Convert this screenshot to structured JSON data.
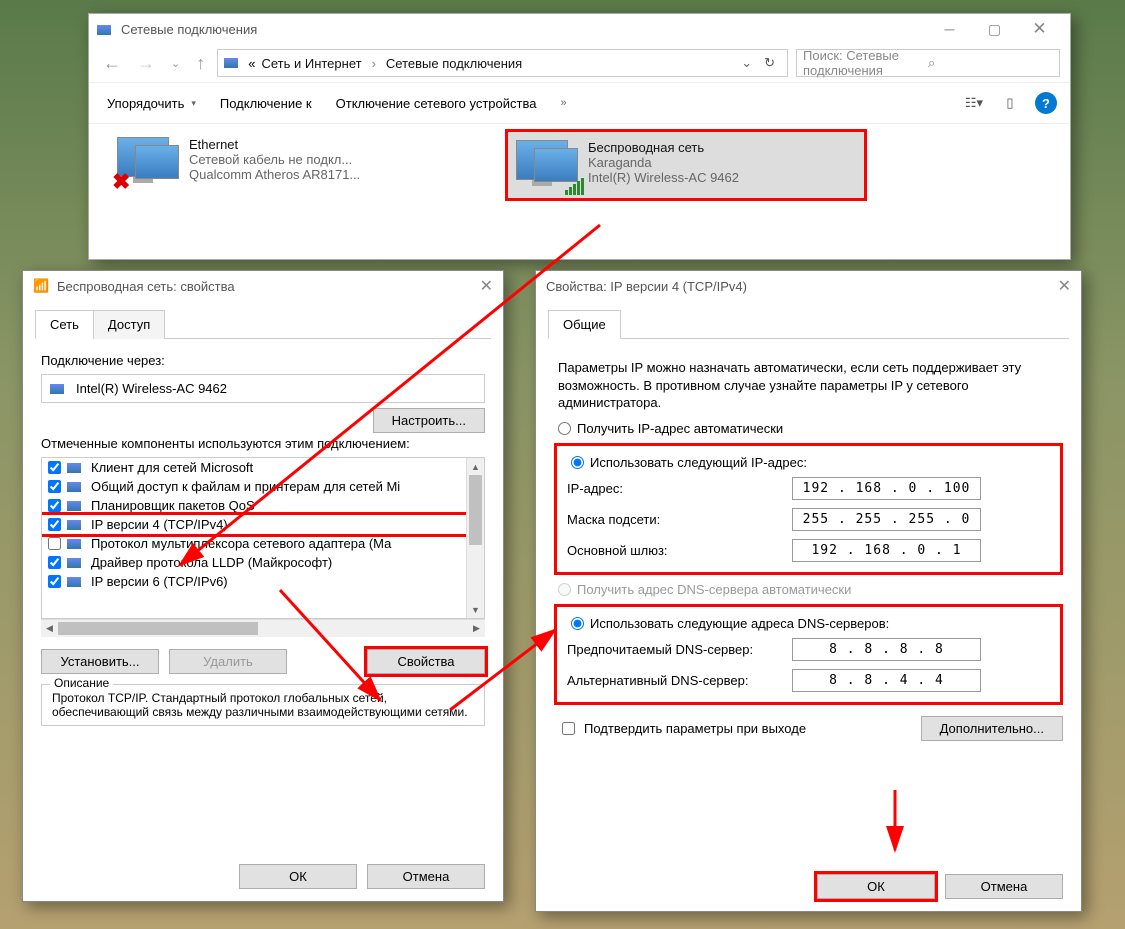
{
  "explorer": {
    "title": "Сетевые подключения",
    "breadcrumb_prefix": "«",
    "breadcrumb1": "Сеть и Интернет",
    "breadcrumb2": "Сетевые подключения",
    "search_placeholder": "Поиск: Сетевые подключения",
    "tb_organize": "Упорядочить",
    "tb_connect": "Подключение к",
    "tb_disable": "Отключение сетевого устройства",
    "tb_more": "»",
    "conn1": {
      "name": "Ethernet",
      "status": "Сетевой кабель не подкл...",
      "adapter": "Qualcomm Atheros AR8171..."
    },
    "conn2": {
      "name": "Беспроводная сеть",
      "status": "Karaganda",
      "adapter": "Intel(R) Wireless-AC 9462"
    }
  },
  "props1": {
    "title": "Беспроводная сеть: свойства",
    "tab_net": "Сеть",
    "tab_access": "Доступ",
    "connect_via": "Подключение через:",
    "adapter": "Intel(R) Wireless-AC 9462",
    "btn_configure": "Настроить...",
    "components_label": "Отмеченные компоненты используются этим подключением:",
    "components": [
      {
        "chk": true,
        "label": "Клиент для сетей Microsoft"
      },
      {
        "chk": true,
        "label": "Общий доступ к файлам и принтерам для сетей Mi"
      },
      {
        "chk": true,
        "label": "Планировщик пакетов QoS"
      },
      {
        "chk": true,
        "label": "IP версии 4 (TCP/IPv4)"
      },
      {
        "chk": false,
        "label": "Протокол мультиплексора сетевого адаптера (Ма"
      },
      {
        "chk": true,
        "label": "Драйвер протокола LLDP (Майкрософт)"
      },
      {
        "chk": true,
        "label": "IP версии 6 (TCP/IPv6)"
      }
    ],
    "btn_install": "Установить...",
    "btn_remove": "Удалить",
    "btn_props": "Свойства",
    "desc_legend": "Описание",
    "desc_text": "Протокол TCP/IP. Стандартный протокол глобальных сетей, обеспечивающий связь между различными взаимодействующими сетями.",
    "btn_ok": "ОК",
    "btn_cancel": "Отмена"
  },
  "props2": {
    "title": "Свойства: IP версии 4 (TCP/IPv4)",
    "tab_general": "Общие",
    "info": "Параметры IP можно назначать автоматически, если сеть поддерживает эту возможность. В противном случае узнайте параметры IP у сетевого администратора.",
    "radio_auto_ip": "Получить IP-адрес автоматически",
    "radio_use_ip": "Использовать следующий IP-адрес:",
    "lbl_ip": "IP-адрес:",
    "val_ip": "192 . 168 .  0  . 100",
    "lbl_mask": "Маска подсети:",
    "val_mask": "255 . 255 . 255 .  0",
    "lbl_gateway": "Основной шлюз:",
    "val_gateway": "192 . 168 .  0  .  1",
    "radio_auto_dns": "Получить адрес DNS-сервера автоматически",
    "radio_use_dns": "Использовать следующие адреса DNS-серверов:",
    "lbl_dns1": "Предпочитаемый DNS-сервер:",
    "val_dns1": "8  .  8  .  8  .  8",
    "lbl_dns2": "Альтернативный DNS-сервер:",
    "val_dns2": "8  .  8  .  4  .  4",
    "chk_validate": "Подтвердить параметры при выходе",
    "btn_advanced": "Дополнительно...",
    "btn_ok": "ОК",
    "btn_cancel": "Отмена"
  }
}
